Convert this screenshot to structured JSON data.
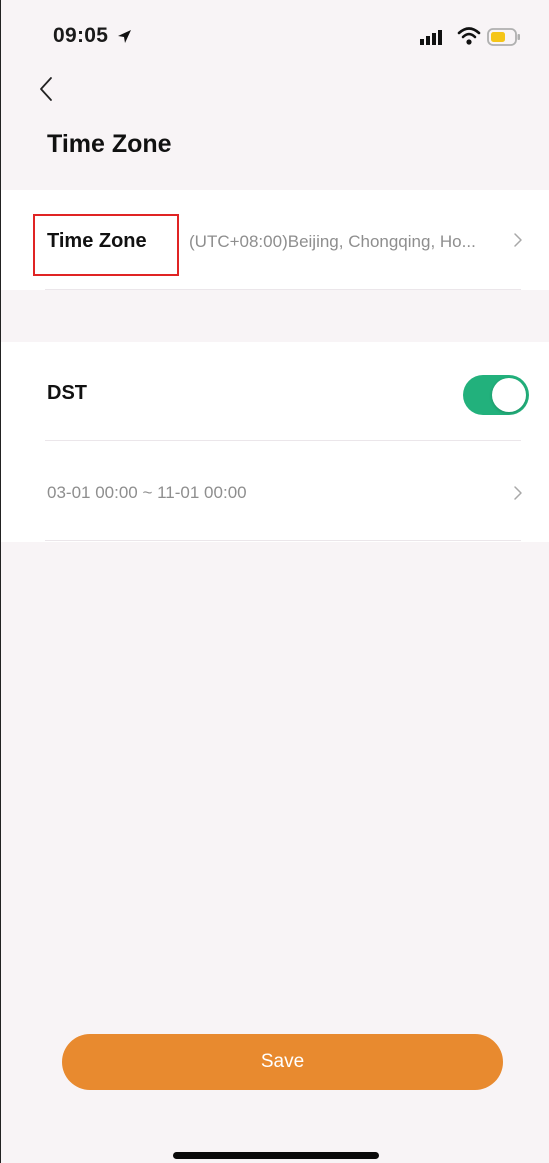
{
  "status_bar": {
    "time": "09:05"
  },
  "header": {
    "title": "Time Zone"
  },
  "time_zone": {
    "label": "Time Zone",
    "value": "(UTC+08:00)Beijing, Chongqing, Ho..."
  },
  "dst": {
    "label": "DST",
    "enabled": true,
    "range": "03-01 00:00 ~ 11-01 00:00"
  },
  "footer": {
    "save_label": "Save"
  },
  "colors": {
    "accent": "#e88a2f",
    "toggle_on": "#22b17c",
    "highlight_border": "#e02424"
  }
}
